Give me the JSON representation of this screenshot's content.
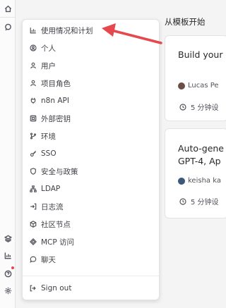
{
  "sidebar_rail": {
    "icons": [
      "home-icon",
      "search-icon",
      "templates-icon",
      "insights-icon",
      "help-icon",
      "settings-icon"
    ],
    "notification_color": "#e5484d"
  },
  "main": {
    "section_title": "从模板开始",
    "cards": [
      {
        "title": "Build your",
        "author": "Lucas Pe",
        "meta": "5 分钟设"
      },
      {
        "title_line1": "Auto-gene",
        "title_line2": "GPT-4, Ap",
        "author": "keisha ka",
        "meta": "5 分钟设"
      }
    ]
  },
  "menu": {
    "items": [
      {
        "label": "使用情况和计划",
        "icon": "usage-chart-icon"
      },
      {
        "label": "个人",
        "icon": "personal-icon"
      },
      {
        "label": "用户",
        "icon": "user-icon"
      },
      {
        "label": "项目角色",
        "icon": "project-role-icon"
      },
      {
        "label": "n8n API",
        "icon": "api-plug-icon"
      },
      {
        "label": "外部密钥",
        "icon": "vault-icon"
      },
      {
        "label": "环境",
        "icon": "git-branch-icon"
      },
      {
        "label": "SSO",
        "icon": "key-icon"
      },
      {
        "label": "安全与政策",
        "icon": "shield-icon"
      },
      {
        "label": "LDAP",
        "icon": "network-icon"
      },
      {
        "label": "日志流",
        "icon": "log-in-icon"
      },
      {
        "label": "社区节点",
        "icon": "box-icon"
      },
      {
        "label": "MCP 访问",
        "icon": "mcp-icon"
      },
      {
        "label": "聊天",
        "icon": "chat-icon"
      }
    ],
    "sign_out": {
      "label": "Sign out",
      "icon": "sign-out-icon"
    }
  },
  "annotation": {
    "arrow_color": "#e5484d"
  }
}
